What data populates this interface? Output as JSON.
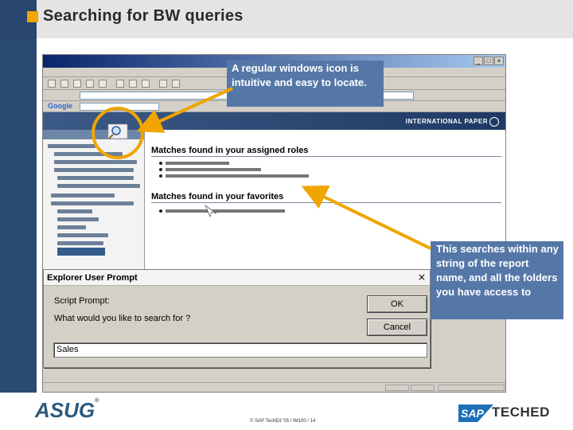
{
  "slide": {
    "title": "Searching for BW queries",
    "accent_color": "#f0a500",
    "brand_color": "#2b4a73"
  },
  "browser": {
    "window_buttons": [
      "_",
      "□",
      "×"
    ],
    "google_label": "Google",
    "international_paper_logo": "INTERNATIONAL PAPER"
  },
  "portal": {
    "section_roles": "Matches found in your assigned roles",
    "section_favorites": "Matches found in your favorites"
  },
  "dialog": {
    "title": "Explorer User Prompt",
    "close_glyph": "×",
    "script_prompt_label": "Script Prompt:",
    "question": "What would you like to search for ?",
    "ok_label": "OK",
    "cancel_label": "Cancel",
    "input_value": "Sales"
  },
  "callouts": {
    "icon_note": "A regular windows icon is intuitive and easy to locate.",
    "search_note": "This searches within any string of the report name, and all the folders you have access to",
    "color": "#5577a8",
    "highlight_color": "#f0a500"
  },
  "footer": {
    "asug_logo": "ASUG",
    "asug_tm": "®",
    "copyright": "© SAP TechEd '05 / IM100 / 14",
    "sap_logo": "SAP",
    "teched_logo": "TECHED"
  }
}
